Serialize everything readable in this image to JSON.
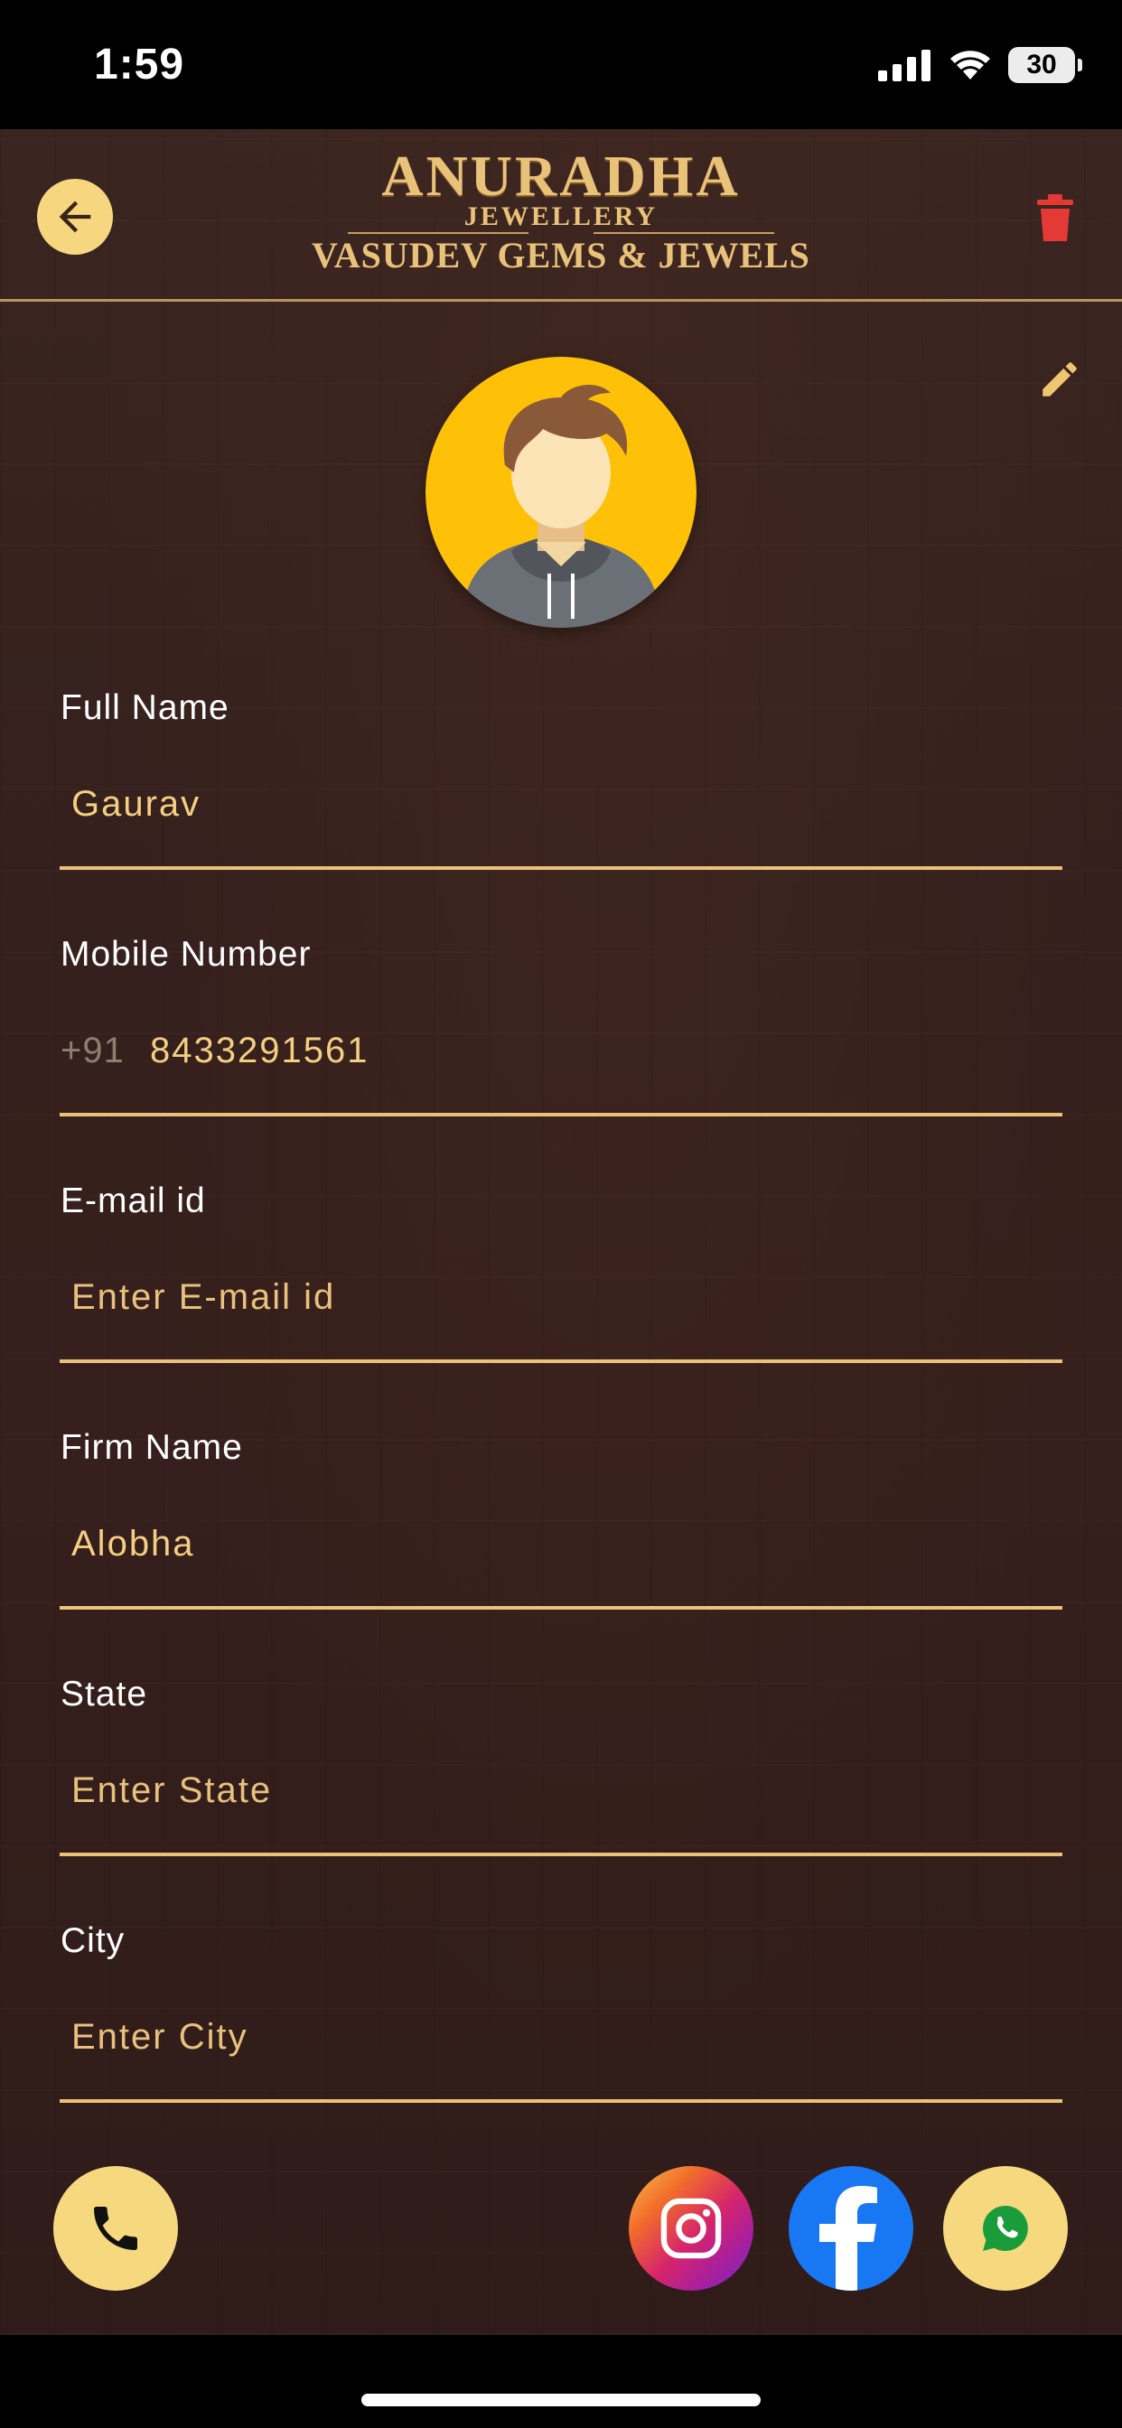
{
  "status_bar": {
    "time": "1:59",
    "battery": "30"
  },
  "header": {
    "logo_title": "ANURADHA",
    "logo_subtitle": "JEWELLERY",
    "logo_tagline": "VASUDEV GEMS & JEWELS"
  },
  "form": {
    "full_name": {
      "label": "Full Name",
      "value": "Gaurav"
    },
    "mobile": {
      "label": "Mobile Number",
      "prefix": "+91",
      "value": "8433291561"
    },
    "email": {
      "label": "E-mail id",
      "placeholder": "Enter E-mail id"
    },
    "firm": {
      "label": "Firm Name",
      "value": "Alobha"
    },
    "state": {
      "label": "State",
      "placeholder": "Enter State"
    },
    "city": {
      "label": "City",
      "placeholder": "Enter City"
    }
  },
  "colors": {
    "gold": "#e9c27a",
    "button_yellow": "#f6d97f",
    "delete_red": "#e53935",
    "facebook": "#1877f2",
    "whatsapp": "#1a9c3b"
  }
}
